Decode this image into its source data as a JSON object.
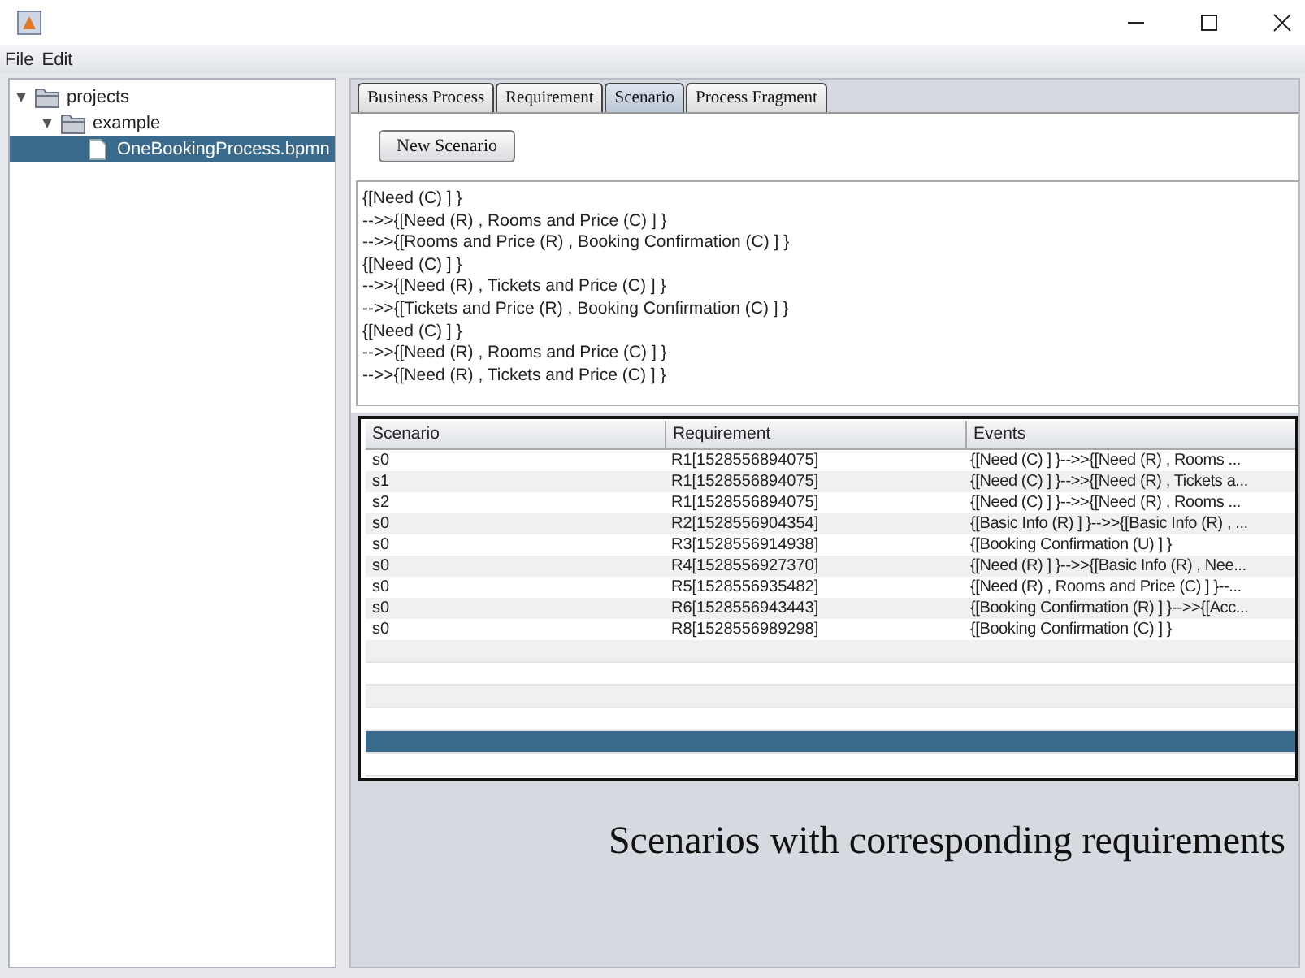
{
  "menu": [
    "File",
    "Edit"
  ],
  "tree": [
    {
      "label": "projects",
      "kind": "folder",
      "expanded": true,
      "selected": false,
      "children": [
        {
          "label": "example",
          "kind": "folder",
          "expanded": true,
          "selected": false,
          "children": [
            {
              "label": "OneBookingProcess.bpmn",
              "kind": "file",
              "selected": true
            }
          ]
        }
      ]
    }
  ],
  "tabs": [
    {
      "label": "Business Process",
      "selected": false
    },
    {
      "label": "Requirement",
      "selected": false
    },
    {
      "label": "Scenario",
      "selected": true
    },
    {
      "label": "Process Fragment",
      "selected": false
    }
  ],
  "new_button": "New Scenario",
  "scenario_text": [
    "{[Need (C) ] }",
    "-->>{[Need (R) , Rooms and Price (C) ] }",
    "-->>{[Rooms and Price (R) , Booking Confirmation (C) ] }",
    "{[Need (C) ] }",
    "-->>{[Need (R) , Tickets and Price (C) ] }",
    "-->>{[Tickets and Price (R) , Booking Confirmation (C) ] }",
    "{[Need (C) ] }",
    "-->>{[Need (R) , Rooms and Price (C) ] }",
    "-->>{[Need (R) , Tickets and Price (C) ] }"
  ],
  "table": {
    "columns": [
      "Scenario",
      "Requirement",
      "Events"
    ],
    "rows": [
      {
        "cells": [
          "s0",
          "R1[1528556894075]",
          "{[Need (C) ] }-->>{[Need (R) , Rooms ..."
        ],
        "selected": false
      },
      {
        "cells": [
          "s1",
          "R1[1528556894075]",
          "{[Need (C) ] }-->>{[Need (R) , Tickets a..."
        ],
        "selected": false
      },
      {
        "cells": [
          "s2",
          "R1[1528556894075]",
          "{[Need (C) ] }-->>{[Need (R) , Rooms ..."
        ],
        "selected": false
      },
      {
        "cells": [
          "s0",
          "R2[1528556904354]",
          "{[Basic Info (R) ] }-->>{[Basic Info (R) , ..."
        ],
        "selected": false
      },
      {
        "cells": [
          "s0",
          "R3[1528556914938]",
          "{[Booking Confirmation (U) ] }"
        ],
        "selected": false
      },
      {
        "cells": [
          "s0",
          "R4[1528556927370]",
          "{[Need (R) ] }-->>{[Basic Info (R) , Nee..."
        ],
        "selected": false
      },
      {
        "cells": [
          "s0",
          "R5[1528556935482]",
          "{[Need (R) , Rooms and Price (C) ] }--..."
        ],
        "selected": false
      },
      {
        "cells": [
          "s0",
          "R6[1528556943443]",
          "{[Booking Confirmation (R) ] }-->>{[Acc..."
        ],
        "selected": false
      },
      {
        "cells": [
          "s0",
          "R8[1528556989298]",
          "{[Booking Confirmation (C) ] }"
        ],
        "selected": false
      }
    ],
    "blank_rows": [
      {
        "selected": false
      },
      {
        "selected": false
      },
      {
        "selected": false
      },
      {
        "selected": false
      },
      {
        "selected": true
      },
      {
        "selected": false
      }
    ]
  },
  "caption": "Scenarios with corresponding requirements"
}
